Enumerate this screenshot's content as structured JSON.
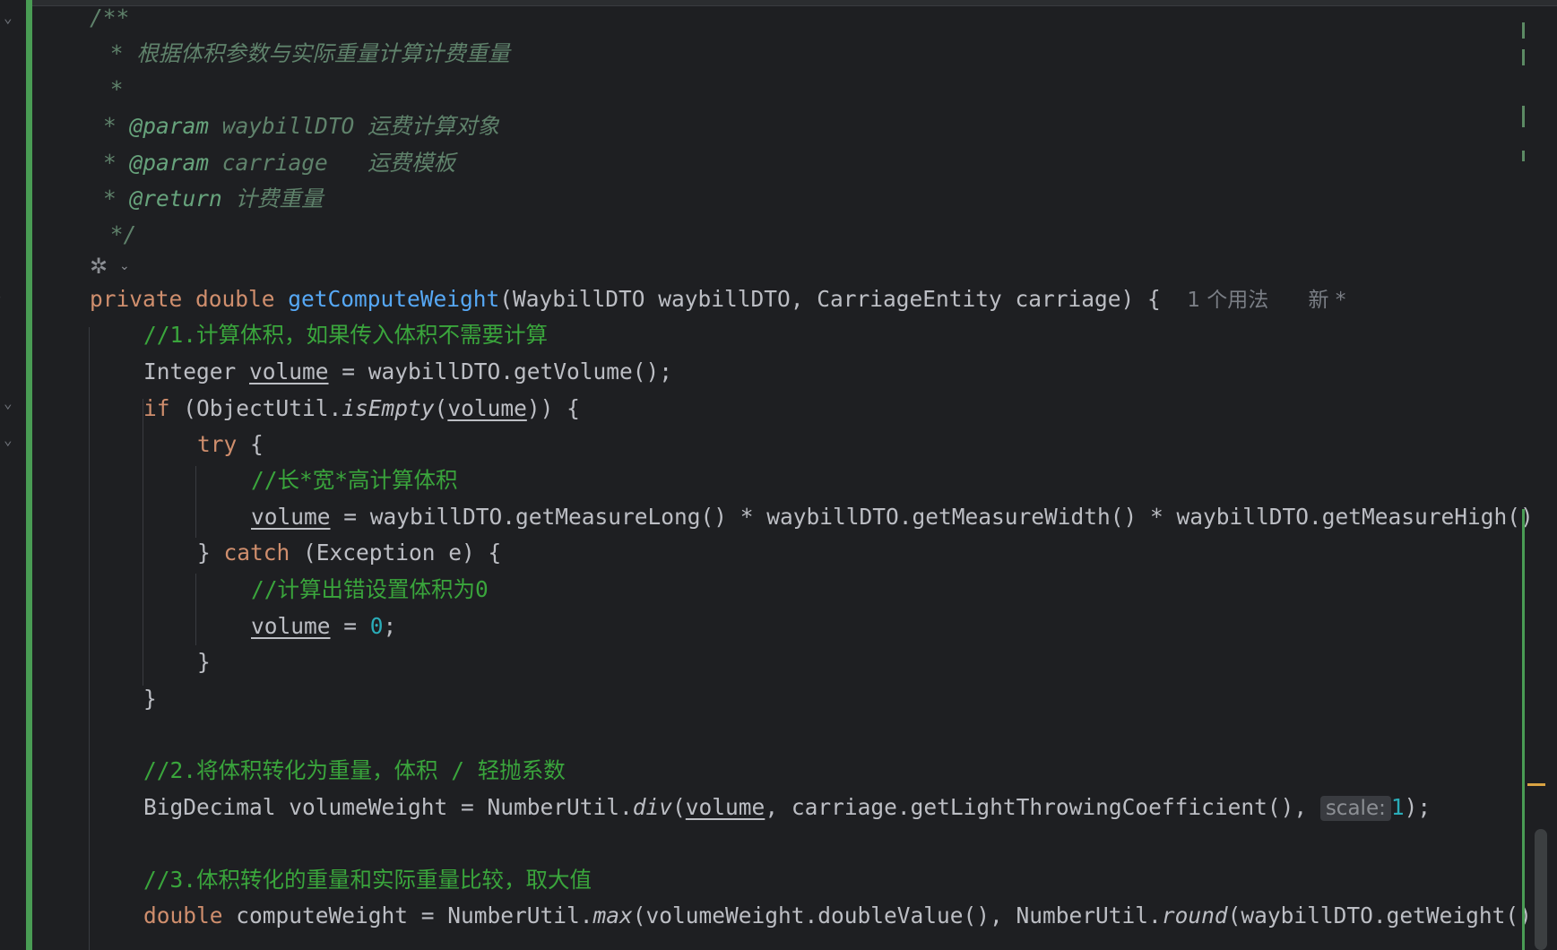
{
  "editor": {
    "language": "java",
    "lines": {
      "doc_open": "/**",
      "doc_desc": " * 根据体积参数与实际重量计算计费重量",
      "doc_blank": " *",
      "doc_param1_tag": "@param",
      "doc_param1_name": " waybillDTO ",
      "doc_param1_desc": "运费计算对象",
      "doc_param2_tag": "@param",
      "doc_param2_name": " carriage   ",
      "doc_param2_desc": "运费模板",
      "doc_return_tag": "@return",
      "doc_return_desc": " 计费重量",
      "doc_close": " */",
      "sig_mod": "private double ",
      "sig_name": "getComputeWeight",
      "sig_params": "(WaybillDTO waybillDTO, CarriageEntity carriage) {",
      "sig_usages": "1 个用法",
      "sig_new": "新 *",
      "c1": "//1.计算体积，如果传入体积不需要计算",
      "l_integer": "Integer ",
      "v_volume": "volume",
      "l_getvolume": " = waybillDTO.getVolume();",
      "kw_if": "if",
      "l_if_open": " (ObjectUtil.",
      "m_isempty": "isEmpty",
      "l_if_close": ")) {",
      "kw_try": "try",
      "brace_open": " {",
      "c_lwh": "//长*宽*高计算体积",
      "l_measure": " = waybillDTO.getMeasureLong() * waybillDTO.getMeasureWidth() * waybillDTO.getMeasureHigh()",
      "brace_close_pre": "} ",
      "kw_catch": "catch",
      "l_catch": " (Exception e) {",
      "c_err": "//计算出错设置体积为0",
      "l_eq": " = ",
      "n_zero": "0",
      "semi": ";",
      "brace_close": "}",
      "c2": "//2.将体积转化为重量，体积 / 轻抛系数",
      "l_bigdecimal": "BigDecimal volumeWeight = NumberUtil.",
      "m_div": "div",
      "l_div_args": ", carriage.getLightThrowingCoefficient(), ",
      "inlay_scale": "scale:",
      "n_one": "1",
      "l_div_end": ");",
      "c3": "//3.体积转化的重量和实际重量比较，取大值",
      "kw_double": "double",
      "l_compute": " computeWeight = NumberUtil.",
      "m_max": "max",
      "l_max_args": "(volumeWeight.doubleValue(), NumberUtil.",
      "m_round": "round",
      "l_round_args": "(waybillDTO.getWeight()",
      "paren_open": "("
    }
  },
  "colors": {
    "background": "#1e1f22",
    "keyword": "#cf8e6d",
    "function": "#56a8f5",
    "comment": "#3aa53c",
    "doc_comment": "#5f826b",
    "number": "#2aacb8",
    "text": "#bcbec4",
    "vcs_added": "#499c54"
  },
  "icons": [
    "fold-chevron-icon",
    "ai-assistant-icon",
    "chevron-down-icon"
  ]
}
